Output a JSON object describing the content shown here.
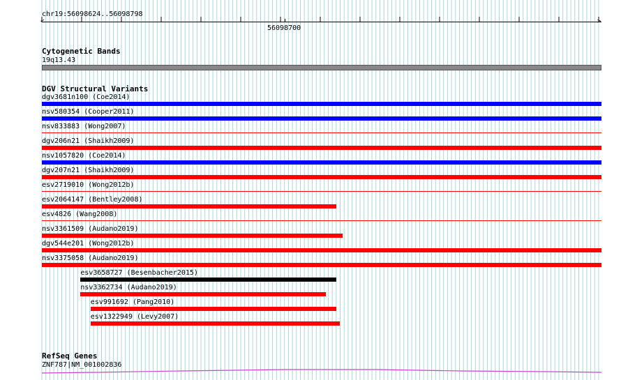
{
  "ruler": {
    "position_label": "chr19:56098624..56098798",
    "center_tick_label": "56098700"
  },
  "cytoband": {
    "title": "Cytogenetic Bands",
    "band_label": "19q13.43",
    "band_color": "#888888"
  },
  "dgv": {
    "title": "DGV Structural Variants",
    "colors": {
      "blue": "#0000ff",
      "red": "#ff0000",
      "black": "#000000"
    },
    "variants": [
      {
        "label": "dgv3681n100 (Coe2014)",
        "color": "blue",
        "style": "thick",
        "start": 0.0,
        "end": 1.0
      },
      {
        "label": "nsv580354 (Cooper2011)",
        "color": "blue",
        "style": "thick",
        "start": 0.0,
        "end": 1.0
      },
      {
        "label": "nsv833883 (Wong2007)",
        "color": "red",
        "style": "thin",
        "start": 0.0,
        "end": 1.0
      },
      {
        "label": "dgv206n21 (Shaikh2009)",
        "color": "red",
        "style": "thick",
        "start": 0.0,
        "end": 1.0
      },
      {
        "label": "nsv1057820 (Coe2014)",
        "color": "blue",
        "style": "thick",
        "start": 0.0,
        "end": 1.0
      },
      {
        "label": "dgv207n21 (Shaikh2009)",
        "color": "red",
        "style": "thick",
        "start": 0.0,
        "end": 1.0
      },
      {
        "label": "esv2719010 (Wong2012b)",
        "color": "red",
        "style": "thin",
        "start": 0.0,
        "end": 1.0
      },
      {
        "label": "esv2064147 (Bentley2008)",
        "color": "red",
        "style": "thick",
        "start": 0.0,
        "end": 0.526
      },
      {
        "label": "esv4826 (Wang2008)",
        "color": "red",
        "style": "thin",
        "start": 0.0,
        "end": 1.0
      },
      {
        "label": "nsv3361509 (Audano2019)",
        "color": "red",
        "style": "thick",
        "start": 0.0,
        "end": 0.538
      },
      {
        "label": "dgv544e201 (Wong2012b)",
        "color": "red",
        "style": "thick",
        "start": 0.0,
        "end": 1.0
      },
      {
        "label": "nsv3375058 (Audano2019)",
        "color": "red",
        "style": "thick",
        "start": 0.0,
        "end": 1.0
      },
      {
        "label": "esv3658727 (Besenbacher2015)",
        "color": "black",
        "style": "thick",
        "start": 0.069,
        "end": 0.526
      },
      {
        "label": "nsv3362734 (Audano2019)",
        "color": "red",
        "style": "thick",
        "start": 0.069,
        "end": 0.508
      },
      {
        "label": "esv991692 (Pang2010)",
        "color": "red",
        "style": "thick",
        "start": 0.087,
        "end": 0.526
      },
      {
        "label": "esv1322949 (Levy2007)",
        "color": "red",
        "style": "thick",
        "start": 0.087,
        "end": 0.532
      }
    ]
  },
  "refseq": {
    "title": "RefSeq Genes",
    "gene_label": "ZNF787|NM_001002836",
    "gene_color": "#cc44cc"
  }
}
